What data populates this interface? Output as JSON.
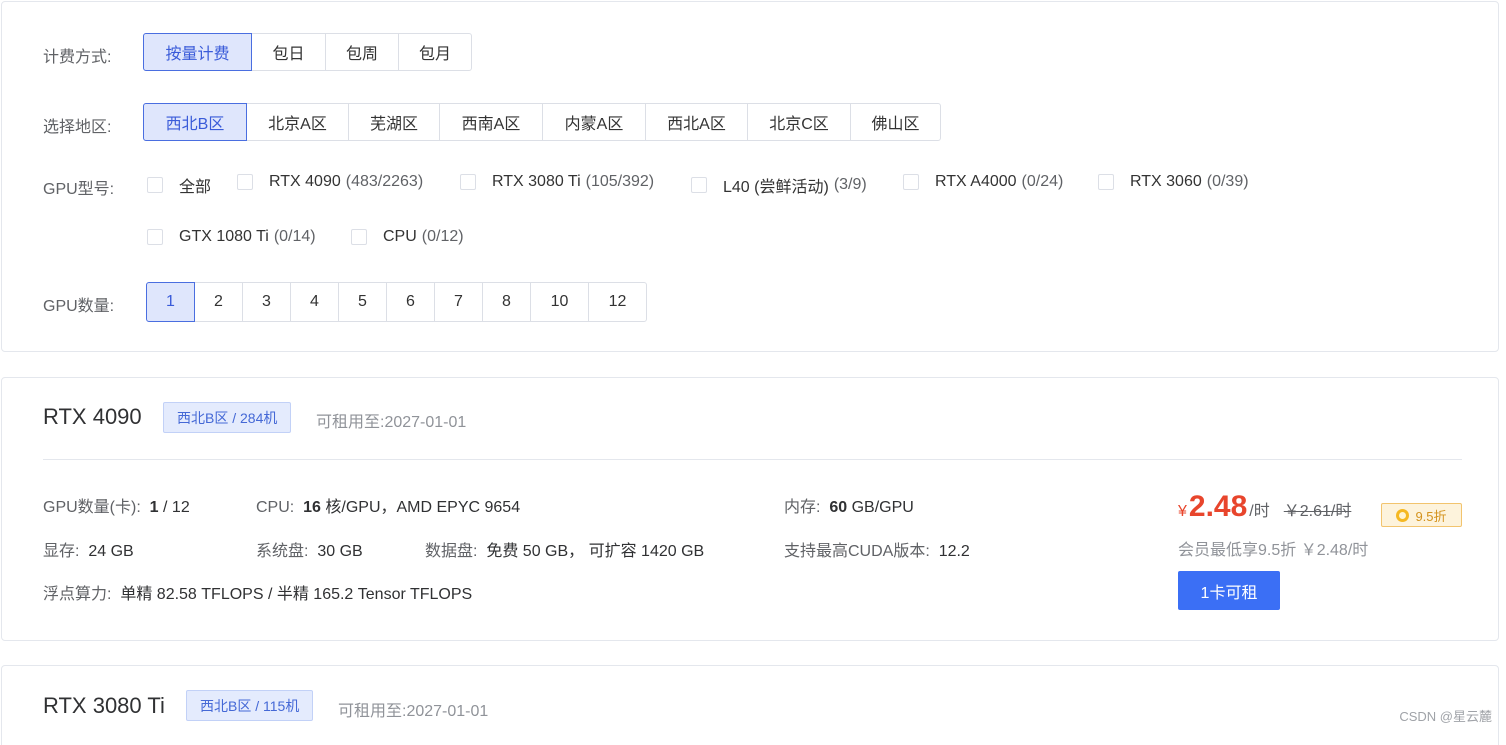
{
  "filters": {
    "billing": {
      "label": "计费方式:",
      "options": [
        "按量计费",
        "包日",
        "包周",
        "包月"
      ],
      "selected": "按量计费"
    },
    "region": {
      "label": "选择地区:",
      "options": [
        "西北B区",
        "北京A区",
        "芜湖区",
        "西南A区",
        "内蒙A区",
        "西北A区",
        "北京C区",
        "佛山区"
      ],
      "selected": "西北B区"
    },
    "gpu_model": {
      "label": "GPU型号:",
      "options": [
        {
          "name": "全部",
          "count": ""
        },
        {
          "name": "RTX 4090",
          "count": "(483/2263)"
        },
        {
          "name": "RTX 3080 Ti",
          "count": "(105/392)"
        },
        {
          "name": "L40 (尝鲜活动)",
          "count": "(3/9)"
        },
        {
          "name": "RTX A4000",
          "count": "(0/24)"
        },
        {
          "name": "RTX 3060",
          "count": "(0/39)"
        },
        {
          "name": "GTX 1080 Ti",
          "count": "(0/14)"
        },
        {
          "name": "CPU",
          "count": "(0/12)"
        }
      ]
    },
    "gpu_count": {
      "label": "GPU数量:",
      "options": [
        "1",
        "2",
        "3",
        "4",
        "5",
        "6",
        "7",
        "8",
        "10",
        "12"
      ],
      "selected": "1"
    }
  },
  "cards": [
    {
      "title": "RTX 4090",
      "tag": "西北B区 / 284机",
      "rent_until_label": "可租用至:",
      "rent_until": "2027-01-01",
      "specs": {
        "gpu_count_label": "GPU数量(卡):",
        "gpu_count_avail": "1",
        "gpu_count_total": "/ 12",
        "cpu_label": "CPU:",
        "cpu_cores": "16",
        "cpu_rest": "核/GPU，AMD EPYC 9654",
        "mem_label": "内存:",
        "mem_value": "60",
        "mem_unit": "GB/GPU",
        "vram_label": "显存:",
        "vram_value": "24 GB",
        "sysdisk_label": "系统盘:",
        "sysdisk_value": "30 GB",
        "datadisk_label": "数据盘:",
        "datadisk_value": "免费 50 GB，  可扩容 1420 GB",
        "cuda_label": "支持最高CUDA版本:",
        "cuda_value": "12.2",
        "flops_label": "浮点算力:",
        "flops_value": "单精 82.58 TFLOPS / 半精 165.2 Tensor TFLOPS"
      },
      "price": {
        "currency": "¥",
        "value": "2.48",
        "unit": "/时",
        "original": "￥2.61/时",
        "discount": "9.5折",
        "member_note": "会员最低享9.5折 ￥2.48/时"
      },
      "rent_button": "1卡可租"
    },
    {
      "title": "RTX 3080 Ti",
      "tag": "西北B区 / 115机",
      "rent_until_label": "可租用至:",
      "rent_until": "2027-01-01"
    }
  ],
  "watermark": "CSDN @星云麓",
  "colors": {
    "accent": "#3b6ff5",
    "price": "#e8452c",
    "active_bg": "#dfe6fc"
  }
}
